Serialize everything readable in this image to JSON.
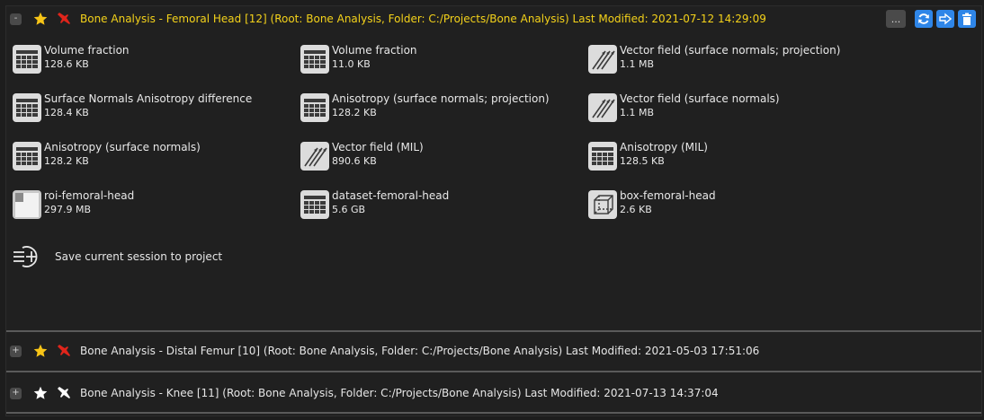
{
  "projects": [
    {
      "toggle": "-",
      "title": "Bone Analysis - Femoral Head [12] (Root: Bone Analysis, Folder: C:/Projects/Bone Analysis) Last Modified: 2021-07-12 14:29:09",
      "starred": true,
      "active": true
    },
    {
      "toggle": "+",
      "title": "Bone Analysis - Distal Femur [10] (Root: Bone Analysis, Folder: C:/Projects/Bone Analysis) Last Modified: 2021-05-03 17:51:06",
      "starred": true,
      "active": false
    },
    {
      "toggle": "+",
      "title": "Bone Analysis - Knee [11] (Root: Bone Analysis, Folder: C:/Projects/Bone Analysis) Last Modified: 2021-07-13 14:37:04",
      "starred": false,
      "active": false
    }
  ],
  "header_buttons": {
    "more": "..."
  },
  "items": [
    {
      "name": "Volume fraction",
      "size": "128.6 KB",
      "icon": "table-icon"
    },
    {
      "name": "Volume fraction",
      "size": "11.0 KB",
      "icon": "table-icon"
    },
    {
      "name": "Vector field (surface normals; projection)",
      "size": "1.1 MB",
      "icon": "vector-field-icon"
    },
    {
      "name": "Surface Normals Anisotropy difference",
      "size": "128.4 KB",
      "icon": "table-icon"
    },
    {
      "name": "Anisotropy (surface normals; projection)",
      "size": "128.2 KB",
      "icon": "table-icon"
    },
    {
      "name": "Vector field (surface normals)",
      "size": "1.1 MB",
      "icon": "vector-field-icon"
    },
    {
      "name": "Anisotropy (surface normals)",
      "size": "128.2 KB",
      "icon": "table-icon"
    },
    {
      "name": "Vector field (MIL)",
      "size": "890.6 KB",
      "icon": "vector-field-icon"
    },
    {
      "name": "Anisotropy (MIL)",
      "size": "128.5 KB",
      "icon": "table-icon"
    },
    {
      "name": "roi-femoral-head",
      "size": "297.9 MB",
      "icon": "roi-icon"
    },
    {
      "name": "dataset-femoral-head",
      "size": "5.6 GB",
      "icon": "table-icon"
    },
    {
      "name": "box-femoral-head",
      "size": "2.6 KB",
      "icon": "box-icon"
    }
  ],
  "save_session": "Save current session to project",
  "colors": {
    "active_title": "#f4d21a",
    "button_blue": "#2f86e8",
    "star": "#f7c417",
    "pin": "#e0251b"
  }
}
